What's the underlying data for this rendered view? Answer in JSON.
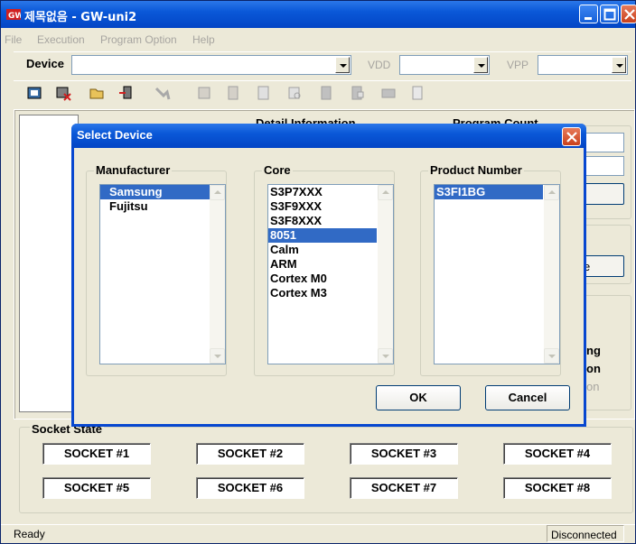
{
  "window": {
    "title": "제목없음 - GW-uni2"
  },
  "menu": [
    "File",
    "Execution",
    "Program Option",
    "Help"
  ],
  "device_bar": {
    "device_label": "Device",
    "device_value": "",
    "vdd_label": "VDD",
    "vdd_value": "",
    "vpp_label": "VPP",
    "vpp_value": ""
  },
  "toolbar_icons": [
    "device-icon",
    "erase-icon",
    "open-file-icon",
    "load-icon",
    "program-icon",
    "blank-check-icon",
    "verify-icon",
    "read-icon",
    "checksum-icon",
    "auto-icon",
    "lock-icon",
    "save-icon",
    "options-icon"
  ],
  "background_partial": {
    "detail_info": "Detail Information",
    "program_count": "Program Count",
    "side_button": "e",
    "side_text_1": "ng",
    "side_text_2": "on",
    "side_text_3": "on"
  },
  "socket_state": {
    "title": "Socket State",
    "sockets": [
      "SOCKET #1",
      "SOCKET #2",
      "SOCKET #3",
      "SOCKET #4",
      "SOCKET #5",
      "SOCKET #6",
      "SOCKET #7",
      "SOCKET #8"
    ]
  },
  "status": {
    "left": "Ready",
    "right": "Disconnected"
  },
  "dialog": {
    "title": "Select Device",
    "manufacturer": {
      "label": "Manufacturer",
      "items": [
        "Samsung",
        "Fujitsu"
      ],
      "selected": "Samsung"
    },
    "core": {
      "label": "Core",
      "items": [
        "S3P7XXX",
        "S3F9XXX",
        "S3F8XXX",
        "8051",
        "Calm",
        "ARM",
        "Cortex M0",
        "Cortex M3"
      ],
      "selected": "8051"
    },
    "product": {
      "label": "Product Number",
      "items": [
        "S3FI1BG"
      ],
      "selected": "S3FI1BG"
    },
    "ok_label": "OK",
    "cancel_label": "Cancel"
  },
  "colors": {
    "titlebar": "#0a58d8",
    "selection": "#316ac5",
    "window_bg": "#ece9d8"
  }
}
